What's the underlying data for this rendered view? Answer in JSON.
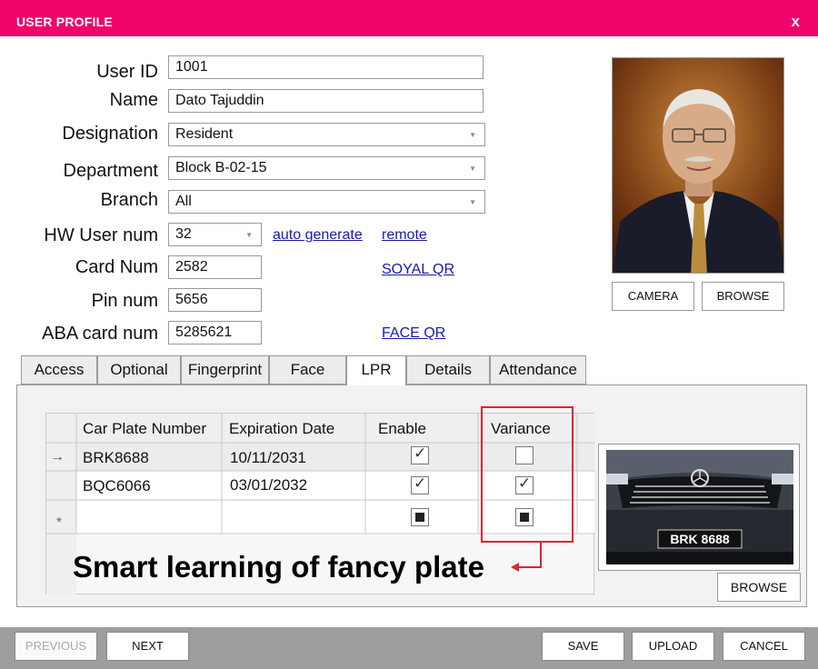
{
  "window": {
    "title": "USER PROFILE",
    "close_label": "x"
  },
  "form": {
    "user_id": {
      "label": "User ID",
      "value": "1001"
    },
    "name": {
      "label": "Name",
      "value": "Dato Tajuddin"
    },
    "designation": {
      "label": "Designation",
      "value": "Resident"
    },
    "department": {
      "label": "Department",
      "value": "Block B-02-15"
    },
    "branch": {
      "label": "Branch",
      "value": "All"
    },
    "hw_user_num": {
      "label": "HW User num",
      "value": "32"
    },
    "card_num": {
      "label": "Card Num",
      "value": "2582"
    },
    "pin_num": {
      "label": "Pin num",
      "value": "5656"
    },
    "aba_card_num": {
      "label": "ABA card num",
      "value": "5285621"
    },
    "links": {
      "auto_generate": "auto generate",
      "remote": "remote",
      "soyal_qr": "SOYAL QR",
      "face_qr": "FACE QR"
    }
  },
  "photo": {
    "camera_label": "CAMERA",
    "browse_label": "BROWSE"
  },
  "tabs": [
    {
      "label": "Access",
      "active": false
    },
    {
      "label": "Optional",
      "active": false
    },
    {
      "label": "Fingerprint",
      "active": false
    },
    {
      "label": "Face",
      "active": false
    },
    {
      "label": "LPR",
      "active": true
    },
    {
      "label": "Details",
      "active": false
    },
    {
      "label": "Attendance",
      "active": false
    }
  ],
  "lpr": {
    "columns": [
      "Car Plate Number",
      "Expiration Date",
      "Enable",
      "Variance"
    ],
    "rows": [
      {
        "indicator": "→",
        "plate": "BRK8688",
        "expiry": "10/11/2031",
        "enable": "checked",
        "variance": "unchecked"
      },
      {
        "indicator": "",
        "plate": "BQC6066",
        "expiry": "03/01/2032",
        "enable": "checked",
        "variance": "checked"
      },
      {
        "indicator": "*",
        "plate": "",
        "expiry": "",
        "enable": "indeterminate",
        "variance": "indeterminate"
      }
    ],
    "caption": "Smart learning of fancy plate",
    "plate_image_text": "BRK 8688",
    "browse_label": "BROWSE",
    "highlight_color": "#e0242c"
  },
  "footer": {
    "previous_label": "PREVIOUS",
    "next_label": "NEXT",
    "save_label": "SAVE",
    "upload_label": "UPLOAD",
    "cancel_label": "CANCEL"
  },
  "colors": {
    "titlebar": "#f0046c",
    "footer": "#9e9e9e",
    "link": "#1a1aa8"
  }
}
